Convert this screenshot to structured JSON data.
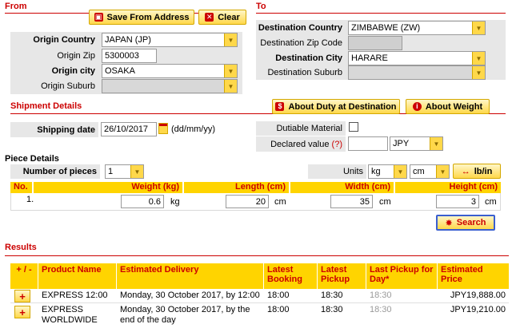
{
  "from": {
    "title": "From",
    "save_button": "Save From Address",
    "clear_button": "Clear",
    "origin_country_label": "Origin Country",
    "origin_country_value": "JAPAN (JP)",
    "origin_zip_label": "Origin Zip",
    "origin_zip_value": "5300003",
    "origin_city_label": "Origin city",
    "origin_city_value": "OSAKA",
    "origin_suburb_label": "Origin Suburb"
  },
  "to": {
    "title": "To",
    "destination_country_label": "Destination Country",
    "destination_country_value": "ZIMBABWE (ZW)",
    "destination_zip_label": "Destination Zip Code",
    "destination_city_label": "Destination City",
    "destination_city_value": "HARARE",
    "destination_suburb_label": "Destination Suburb"
  },
  "shipment": {
    "title": "Shipment Details",
    "duty_button": "About Duty at Destination",
    "weight_button": "About Weight",
    "shipping_date_label": "Shipping date",
    "shipping_date_value": "26/10/2017",
    "date_format": "(dd/mm/yy)",
    "dutiable_label": "Dutiable Material",
    "declared_label": "Declared value",
    "declared_help": "(?)",
    "currency": "JPY"
  },
  "pieces": {
    "title": "Piece Details",
    "number_label": "Number of pieces",
    "number_value": "1",
    "units_label": "Units",
    "weight_unit": "kg",
    "length_unit": "cm",
    "convert_button": "lb/in",
    "headers": {
      "no": "No.",
      "weight": "Weight (kg)",
      "length": "Length (cm)",
      "width": "Width (cm)",
      "height": "Height (cm)"
    },
    "row": {
      "no": "1.",
      "weight": "0.6",
      "weight_unit": "kg",
      "length": "20",
      "length_unit": "cm",
      "width": "35",
      "width_unit": "cm",
      "height": "3",
      "height_unit": "cm"
    },
    "search_button": "Search"
  },
  "results": {
    "title": "Results",
    "headers": {
      "toggle": "+ / -",
      "product": "Product Name",
      "delivery": "Estimated Delivery",
      "latest_booking": "Latest Booking",
      "latest_pickup": "Latest Pickup",
      "last_pickup_day": "Last Pickup for Day*",
      "price": "Estimated Price"
    },
    "rows": [
      {
        "toggle": "+",
        "product": "EXPRESS 12:00",
        "delivery": "Monday, 30 October 2017, by 12:00",
        "latest_booking": "18:00",
        "latest_pickup": "18:30",
        "last_pickup_day": "18:30",
        "price": "JPY19,888.00"
      },
      {
        "toggle": "+",
        "product": "EXPRESS WORLDWIDE",
        "delivery": "Monday, 30 October 2017, by the end of the day",
        "latest_booking": "18:00",
        "latest_pickup": "18:30",
        "last_pickup_day": "18:30",
        "price": "JPY19,210.00"
      }
    ]
  },
  "colors": {
    "accent_red": "#cc0000",
    "brand_yellow": "#ffd400",
    "label_gray": "#e7e7e7"
  }
}
